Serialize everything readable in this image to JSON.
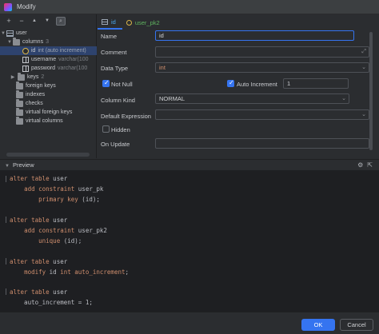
{
  "window": {
    "title": "Modify"
  },
  "toolbar": {
    "add": "+",
    "remove": "−",
    "up": "▲",
    "down": "▼",
    "extra": "🔍"
  },
  "tree": {
    "table": "user",
    "columns_label": "columns",
    "columns_count": "3",
    "columns": [
      {
        "name": "id",
        "type": "int (auto increment)"
      },
      {
        "name": "username",
        "type": "varchar(100"
      },
      {
        "name": "password",
        "type": "varchar(100"
      }
    ],
    "keys_label": "keys",
    "keys_count": "2",
    "others": [
      "foreign keys",
      "indexes",
      "checks",
      "virtual foreign keys",
      "virtual columns"
    ]
  },
  "tabs": [
    {
      "label": "id"
    },
    {
      "label": "user_pk2"
    }
  ],
  "form": {
    "name_label": "Name",
    "name_value": "id",
    "comment_label": "Comment",
    "comment_value": "",
    "datatype_label": "Data Type",
    "datatype_value": "int",
    "notnull_label": "Not Null",
    "notnull_checked": true,
    "autoinc_label": "Auto Increment",
    "autoinc_checked": true,
    "autoinc_value": "1",
    "columnkind_label": "Column Kind",
    "columnkind_value": "NORMAL",
    "default_label": "Default Expression",
    "default_value": "",
    "hidden_label": "Hidden",
    "hidden_checked": false,
    "onupdate_label": "On Update",
    "onupdate_value": ""
  },
  "preview": {
    "title": "Preview",
    "lines": [
      [
        "alter table user"
      ],
      [
        "    add constraint user_pk"
      ],
      [
        "        primary key (id);"
      ],
      [
        ""
      ],
      [
        "alter table user"
      ],
      [
        "    add constraint user_pk2"
      ],
      [
        "        unique (id);"
      ],
      [
        ""
      ],
      [
        "alter table user"
      ],
      [
        "    modify id int auto_increment;"
      ],
      [
        ""
      ],
      [
        "alter table user"
      ],
      [
        "    auto_increment = 1;"
      ]
    ]
  },
  "buttons": {
    "ok": "OK",
    "cancel": "Cancel"
  },
  "colors": {
    "accent": "#3574f0",
    "keyword": "#cf8e6d",
    "tab_link": "#4aa8ee",
    "tab_green": "#5fb35f"
  }
}
